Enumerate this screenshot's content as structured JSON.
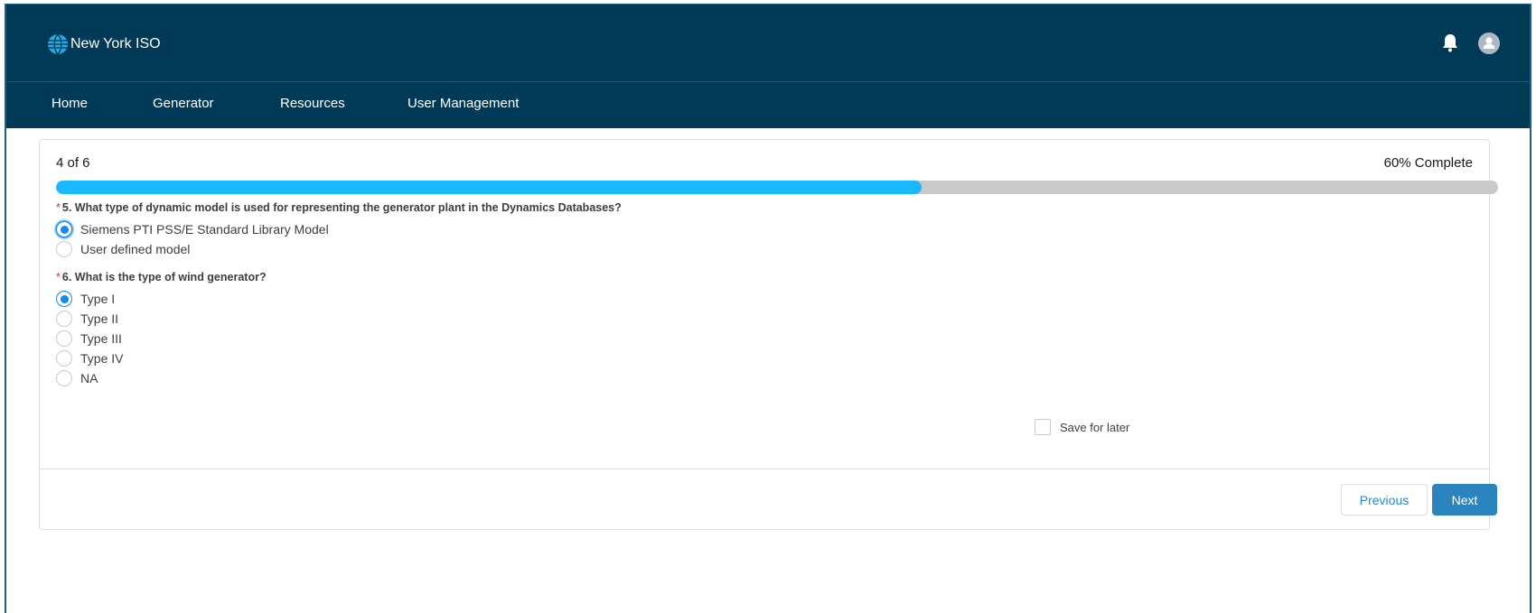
{
  "header": {
    "brand": "New York ISO",
    "notifications_icon": "bell-icon",
    "user_icon": "user-avatar-icon"
  },
  "nav": {
    "items": [
      {
        "label": "Home"
      },
      {
        "label": "Generator"
      },
      {
        "label": "Resources"
      },
      {
        "label": "User Management"
      }
    ]
  },
  "wizard": {
    "step_text": "4 of 6",
    "complete_text": "60% Complete",
    "progress_percent": 60,
    "required_mark": "*",
    "questions": [
      {
        "label": "5. What type of dynamic model is used for representing the generator plant in the Dynamics Databases?",
        "options": [
          {
            "label": "Siemens PTI PSS/E Standard Library Model",
            "selected": true
          },
          {
            "label": "User defined model",
            "selected": false
          }
        ]
      },
      {
        "label": "6. What is the type of wind generator?",
        "options": [
          {
            "label": "Type I",
            "selected": true
          },
          {
            "label": "Type II",
            "selected": false
          },
          {
            "label": "Type III",
            "selected": false
          },
          {
            "label": "Type IV",
            "selected": false
          },
          {
            "label": "NA",
            "selected": false
          }
        ]
      }
    ],
    "save_for_later_label": "Save for later",
    "save_for_later_checked": false,
    "previous_label": "Previous",
    "next_label": "Next"
  },
  "colors": {
    "header_bg": "#003a57",
    "progress_fill": "#1ab9ff",
    "progress_track": "#c9c9c9",
    "primary_button": "#2a85be",
    "required": "#c23934"
  }
}
